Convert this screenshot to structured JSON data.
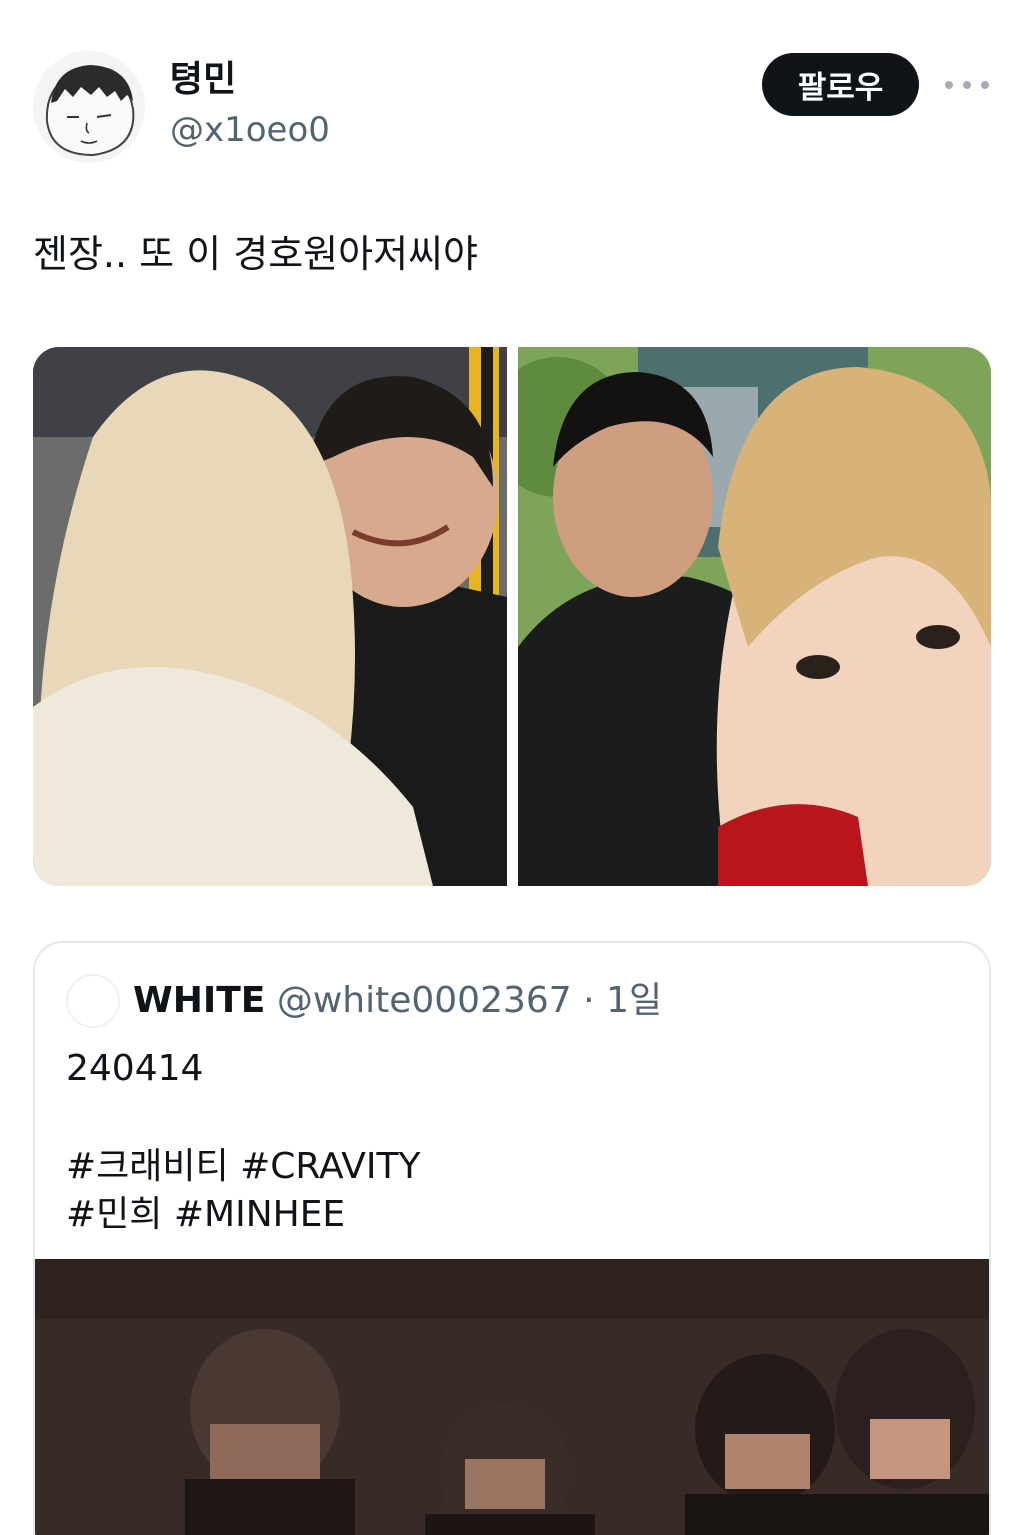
{
  "author": {
    "display_name": "텽민",
    "handle": "@x1oeo0"
  },
  "follow_label": "팔로우",
  "tweet": {
    "text": "젠장.. 또 이 경호원아저씨야"
  },
  "quoted": {
    "name": "WHITE",
    "handle": "@white0002367",
    "separator": "·",
    "time": "1일",
    "date_line": "240414",
    "hashtags_line1": "#크래비티 #CRAVITY",
    "hashtags_line2": "#민희 #MINHEE"
  },
  "icons": {
    "more": "more-horizontal-icon"
  }
}
